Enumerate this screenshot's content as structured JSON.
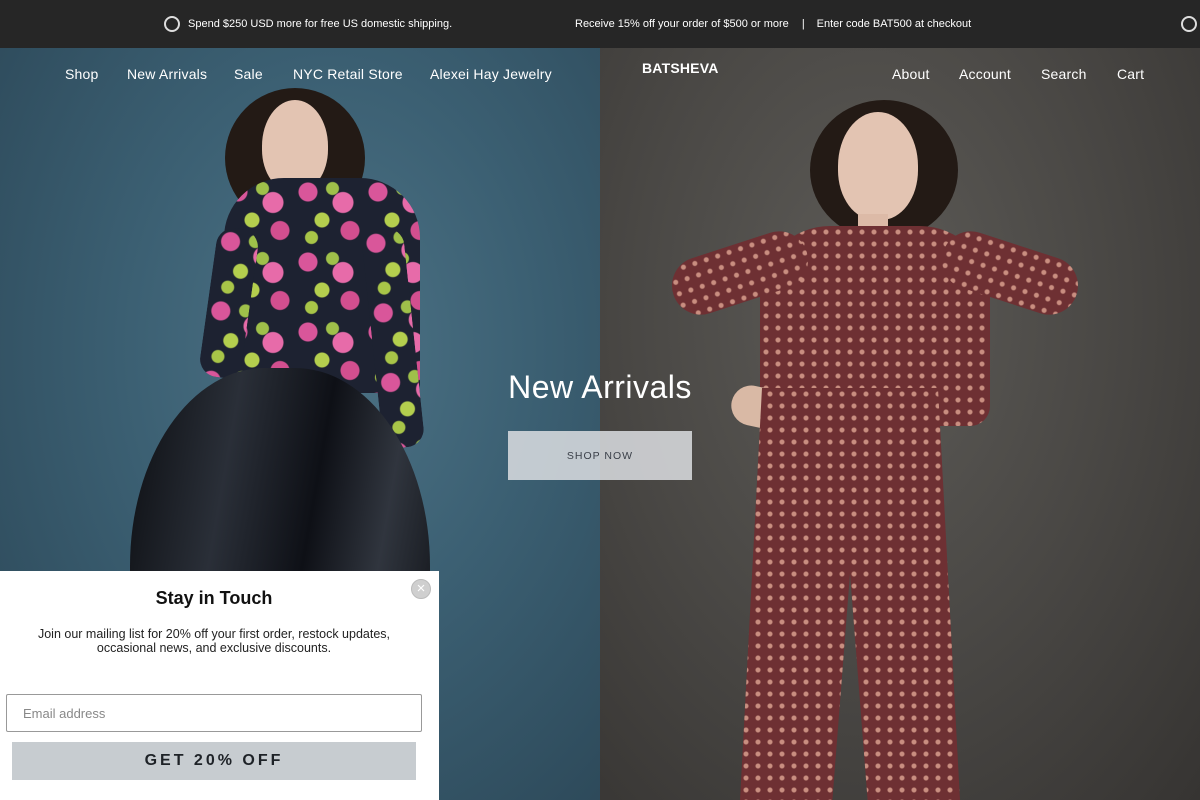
{
  "announcement": {
    "shipping": "Spend $250 USD more for free US domestic shipping.",
    "discount": "Receive 15% off your order of $500 or more",
    "separator": "|",
    "code": "Enter code BAT500 at checkout"
  },
  "nav": {
    "left": [
      "Shop",
      "New Arrivals",
      "Sale",
      "NYC Retail Store",
      "Alexei Hay Jewelry"
    ],
    "logo": "BATSHEVA",
    "right": [
      "About",
      "Account",
      "Search",
      "Cart"
    ]
  },
  "hero": {
    "title": "New Arrivals",
    "cta": "SHOP NOW"
  },
  "popup": {
    "title": "Stay in Touch",
    "close": "×",
    "body": "Join our mailing list for 20% off your first order, restock updates, occasional news, and exclusive discounts.",
    "email_placeholder": "Email address",
    "email_value": "",
    "cta": "GET 20% OFF"
  },
  "icons": {
    "announcement_marker": "circle-outline-icon",
    "popup_close": "close-icon"
  },
  "colors": {
    "announcement_bg": "#262626",
    "popup_cta_bg": "#c7ccd0",
    "shop_now_bg": "#dcdee2"
  }
}
